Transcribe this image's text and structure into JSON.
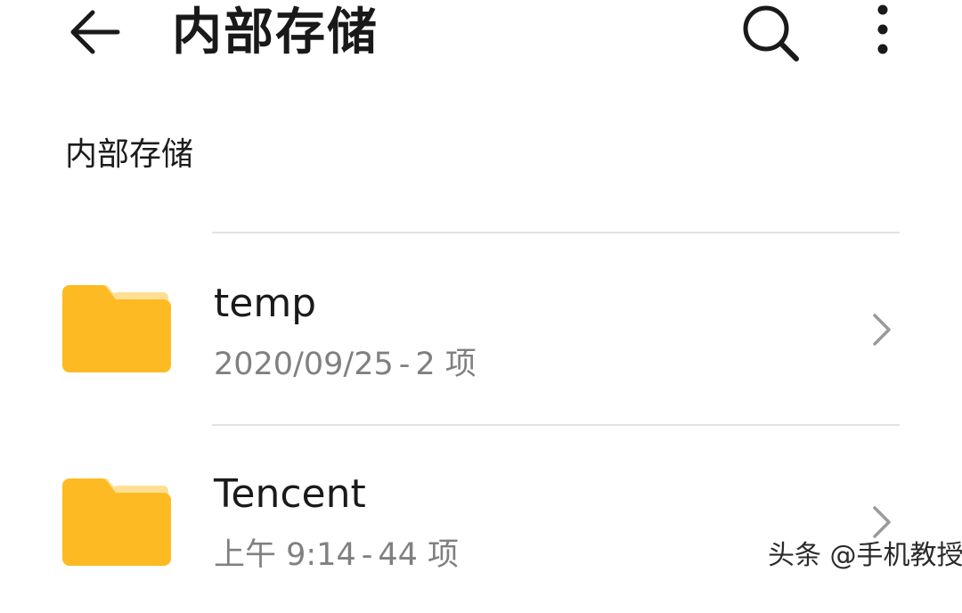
{
  "appbar": {
    "title": "内部存储",
    "icons": {
      "back": "arrow-left-icon",
      "search": "search-icon",
      "more": "more-vertical-icon"
    }
  },
  "breadcrumb": "内部存储",
  "files": [
    {
      "name": "temp",
      "date": "2020/09/25",
      "separator": "-",
      "count": "2 项",
      "icon": "folder-icon"
    },
    {
      "name": "Tencent",
      "date": "上午 9:14",
      "separator": "-",
      "count": "44 项",
      "icon": "folder-icon"
    }
  ],
  "watermark": "头条 @手机教授",
  "colors": {
    "folder": "#FDBA22",
    "folder_tab_light": "#FEDF93",
    "secondary_text": "#808080",
    "divider": "#E2E2E2"
  }
}
